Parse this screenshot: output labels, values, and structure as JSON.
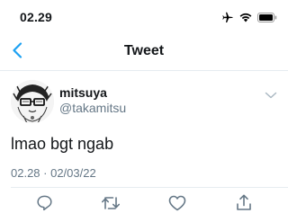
{
  "status_bar": {
    "time": "02.29",
    "icons": [
      "airplane-icon",
      "wifi-icon",
      "battery-icon"
    ]
  },
  "nav": {
    "back_icon": "chevron-left-icon",
    "title": "Tweet"
  },
  "tweet": {
    "author": {
      "display_name": "mitsuya",
      "username": "@takamitsu",
      "avatar_icon": "avatar-drawing"
    },
    "more_icon": "chevron-down-icon",
    "text": "lmao bgt ngab",
    "timestamp": "02.28 · 02/03/22"
  },
  "actions": [
    {
      "name": "reply",
      "icon": "speech-bubble-icon"
    },
    {
      "name": "retweet",
      "icon": "retweet-icon"
    },
    {
      "name": "like",
      "icon": "heart-icon"
    },
    {
      "name": "share",
      "icon": "share-icon"
    }
  ],
  "colors": {
    "accent": "#1da1f2",
    "text": "#14171a",
    "secondary_text": "#657786",
    "divider": "#e6ecf0"
  }
}
